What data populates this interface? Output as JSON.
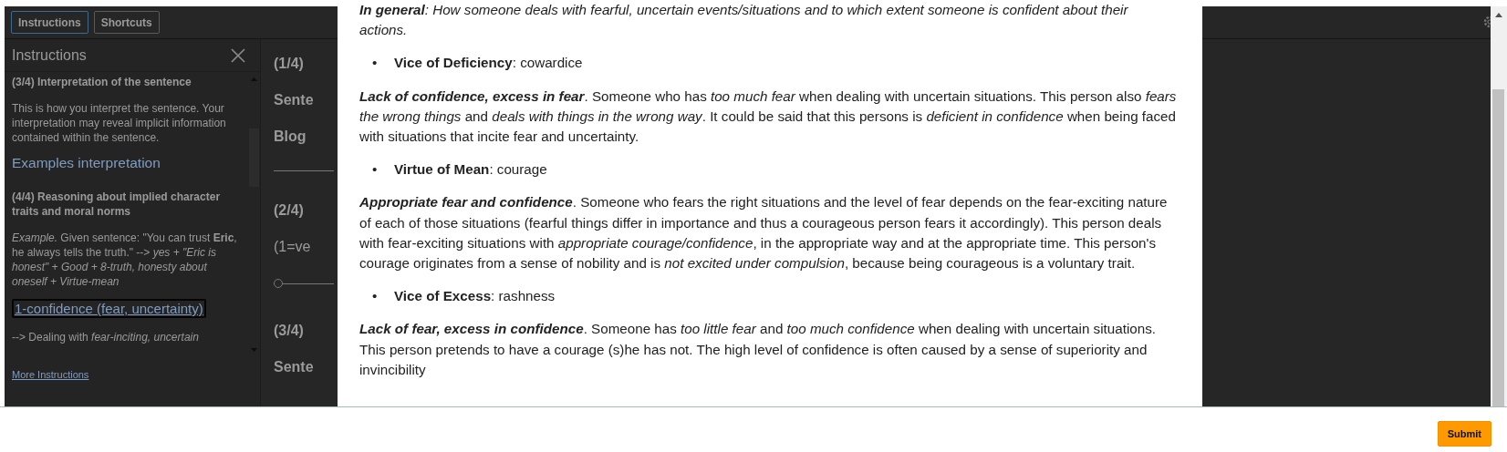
{
  "toolbar": {
    "tabs": [
      {
        "label": "Instructions",
        "selected": true
      },
      {
        "label": "Shortcuts",
        "selected": false
      }
    ]
  },
  "instructions_panel": {
    "title": "Instructions",
    "sections": [
      {
        "kind": "heading",
        "text": "(3/4) Interpretation of the sentence"
      },
      {
        "kind": "paragraph",
        "text": "This is how you interpret the sentence. Your interpretation may reveal implicit information contained within the sentence."
      },
      {
        "kind": "link",
        "text": "Examples interpretation"
      },
      {
        "kind": "heading",
        "text": "(4/4) Reasoning about implied character traits and moral norms"
      },
      {
        "kind": "paragraph",
        "text": "*Example.* Given sentence: \"You can trust **Eric**, he always tells the truth.\" --> *yes + \"Eric is honest\" + Good + 8-truth, honesty about oneself + Virtue-mean*"
      },
      {
        "kind": "button",
        "text": "1-confidence (fear, uncertainty)"
      },
      {
        "kind": "paragraph",
        "text": "--> Dealing with *fear-inciting, uncertain*"
      }
    ],
    "more_link": "More Instructions"
  },
  "task": {
    "items": [
      {
        "kind": "heading",
        "text": "(1/4)"
      },
      {
        "kind": "label",
        "text": "Sente"
      },
      {
        "kind": "label",
        "text": "Blog"
      },
      {
        "kind": "rule"
      },
      {
        "kind": "heading",
        "text": "(2/4)"
      },
      {
        "kind": "hint",
        "text": "(1=ve"
      },
      {
        "kind": "slider",
        "level": 0
      },
      {
        "kind": "heading",
        "text": "(3/4)"
      },
      {
        "kind": "label",
        "text": "Sente"
      }
    ]
  },
  "modal": {
    "blocks": [
      {
        "kind": "summary",
        "lead": "In general",
        "text": ": How someone deals with fearful, uncertain events/situations and to which extent someone is confident about their actions."
      },
      {
        "kind": "bullet",
        "marker": "•",
        "text": "**Vice of Deficiency**: cowardice"
      },
      {
        "kind": "definition",
        "lead": "Lack of confidence, excess in fear",
        "text": ". Someone who has *too much fear* when dealing with uncertain situations. This person also *fears the wrong things* and *deals with things in the wrong way*. It could be said that this persons is *deficient in confidence* when being faced with situations that incite fear and uncertainty."
      },
      {
        "kind": "bullet",
        "marker": "•",
        "text": "**Virtue of Mean**: courage"
      },
      {
        "kind": "definition",
        "lead": "Appropriate fear and confidence",
        "text": ". Someone who fears the right situations and the level of fear depends on the fear-exciting nature of each of those situations (fearful things differ in importance and thus a courageous person fears it accordingly). This person deals with fear-exciting situations with *appropriate courage/confidence*, in the appropriate way and at the appropriate time. This person's courage originates from a sense of nobility and is *not excited under compulsion*, because being courageous is a voluntary trait."
      },
      {
        "kind": "bullet",
        "marker": "•",
        "text": "**Vice of Excess**: rashness"
      },
      {
        "kind": "definition",
        "lead": "Lack of fear, excess in confidence",
        "text": ". Someone has *too little fear* and *too much confidence* when dealing with uncertain situations. This person pretends to have a courage (s)he has not. The high level of confidence is often caused by a sense of superiority and invincibility"
      }
    ]
  },
  "footer": {
    "submit": "Submit"
  }
}
